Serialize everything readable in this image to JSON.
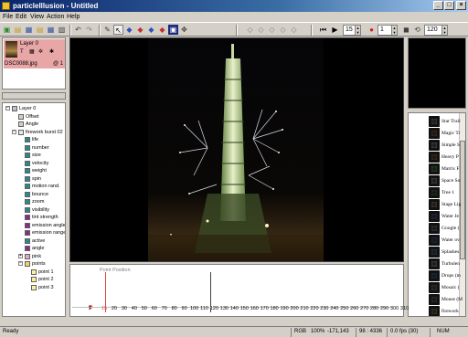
{
  "window": {
    "title": "particleIllusion - Untitled"
  },
  "menu": [
    "File",
    "Edit",
    "View",
    "Action",
    "Help"
  ],
  "toolbar": {
    "frame_value": "15",
    "record_value": "1",
    "fps_value": "120"
  },
  "layers": [
    {
      "name": "Layer 0",
      "file": "DSC0088.jpg",
      "frame_label": "@ 1"
    }
  ],
  "tree": [
    {
      "label": "Layer 0",
      "depth": 0,
      "icon": "layer-icon"
    },
    {
      "label": "Offset",
      "depth": 1,
      "icon": "offset-icon"
    },
    {
      "label": "Angle",
      "depth": 1,
      "icon": "angle-icon"
    },
    {
      "label": "firework burst 02",
      "depth": 1,
      "icon": "emitter-icon"
    },
    {
      "label": "life",
      "depth": 2,
      "icon": "param-icon"
    },
    {
      "label": "number",
      "depth": 2,
      "icon": "param-icon"
    },
    {
      "label": "size",
      "depth": 2,
      "icon": "param-icon"
    },
    {
      "label": "velocity",
      "depth": 2,
      "icon": "param-icon"
    },
    {
      "label": "weight",
      "depth": 2,
      "icon": "param-icon"
    },
    {
      "label": "spin",
      "depth": 2,
      "icon": "param-icon"
    },
    {
      "label": "motion rand.",
      "depth": 2,
      "icon": "param-icon"
    },
    {
      "label": "bounce",
      "depth": 2,
      "icon": "param-icon"
    },
    {
      "label": "zoom",
      "depth": 2,
      "icon": "param-icon"
    },
    {
      "label": "visibility",
      "depth": 2,
      "icon": "param-icon"
    },
    {
      "label": "tint strength",
      "depth": 2,
      "icon": "param-icon-purple"
    },
    {
      "label": "emission angle",
      "depth": 2,
      "icon": "param-icon-purple"
    },
    {
      "label": "emission range",
      "depth": 2,
      "icon": "param-icon-purple"
    },
    {
      "label": "active",
      "depth": 2,
      "icon": "param-icon"
    },
    {
      "label": "angle",
      "depth": 2,
      "icon": "param-icon-purple"
    },
    {
      "label": "pink",
      "depth": 2,
      "icon": "particle-type-icon"
    },
    {
      "label": "points",
      "depth": 2,
      "icon": "folder-icon"
    },
    {
      "label": "point 1",
      "depth": 3,
      "icon": "point-icon"
    },
    {
      "label": "point 2",
      "depth": 3,
      "icon": "point-icon"
    },
    {
      "label": "point 3",
      "depth": 3,
      "icon": "point-icon"
    }
  ],
  "library": [
    "Star Trail",
    "Magic Tr",
    "Simple S",
    "Heavy P",
    "Matrix F",
    "Space So",
    "Tree 1",
    "Stage Lig",
    "Water Je",
    "Google (",
    "Water ov",
    "Splashes",
    "Turbulen",
    "Drops (m",
    "Mosaic (",
    "Mouse (M",
    "firework"
  ],
  "timeline": {
    "label": "Point Position",
    "ticks": [
      "1",
      "15",
      "20",
      "30",
      "40",
      "50",
      "60",
      "70",
      "80",
      "90",
      "100",
      "110",
      "120",
      "130",
      "140",
      "150",
      "160",
      "170",
      "180",
      "190",
      "200",
      "210",
      "220",
      "230",
      "240",
      "250",
      "260",
      "270",
      "280",
      "290",
      "300",
      "310"
    ]
  },
  "status": {
    "ready": "Ready",
    "color_mode": "RGB",
    "zoom": "100%",
    "coords": "-171,143",
    "ratio": "98 : 4336",
    "fps": "0.0 fps (30)",
    "num": "NUM"
  },
  "colors": {
    "title_start": "#0a246a",
    "title_end": "#a6caf0",
    "layer_selected": "#e8a6a6",
    "timeline_marker": "#e04040"
  }
}
